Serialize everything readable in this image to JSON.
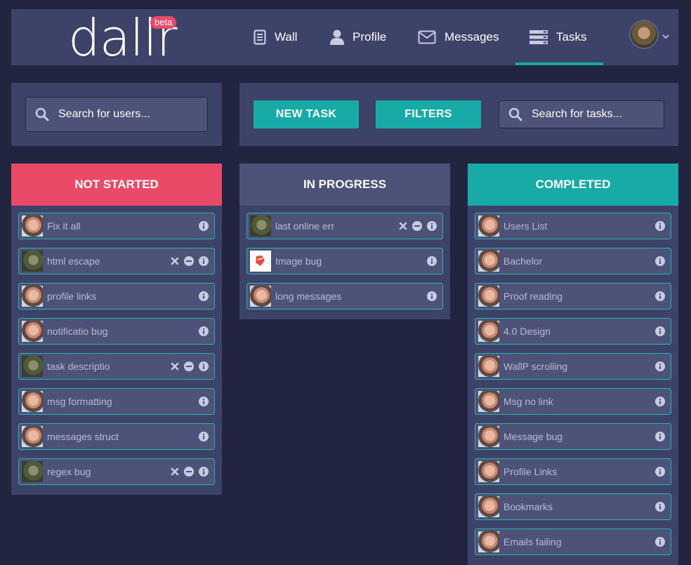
{
  "header": {
    "logo": "dallr",
    "badge": "beta",
    "nav": [
      {
        "label": "Wall",
        "icon": "document-icon"
      },
      {
        "label": "Profile",
        "icon": "user-icon"
      },
      {
        "label": "Messages",
        "icon": "envelope-icon"
      },
      {
        "label": "Tasks",
        "icon": "tasks-icon",
        "active": true
      }
    ]
  },
  "user_search": {
    "placeholder": "Search for users..."
  },
  "toolbar": {
    "new_task": "NEW TASK",
    "filters": "FILTERS",
    "task_search_placeholder": "Search for tasks..."
  },
  "columns": {
    "not_started": {
      "title": "NOT STARTED",
      "color": "#e94a67",
      "tasks": [
        {
          "label": "Fix it all",
          "actions": [
            "info"
          ]
        },
        {
          "label": "html escape",
          "actions": [
            "remove",
            "minus",
            "info"
          ]
        },
        {
          "label": "profile links",
          "actions": [
            "info"
          ]
        },
        {
          "label": "notificatio bug",
          "actions": [
            "info"
          ]
        },
        {
          "label": "task descriptio",
          "actions": [
            "remove",
            "minus",
            "info"
          ]
        },
        {
          "label": "msg formatting",
          "actions": [
            "info"
          ]
        },
        {
          "label": "messages struct",
          "actions": [
            "info"
          ]
        },
        {
          "label": "regex bug",
          "actions": [
            "remove",
            "minus",
            "info"
          ]
        }
      ]
    },
    "in_progress": {
      "title": "IN PROGRESS",
      "color": "#4d5278",
      "tasks": [
        {
          "label": "last online err",
          "actions": [
            "remove",
            "minus",
            "info"
          ]
        },
        {
          "label": "Image bug",
          "actions": [
            "info"
          ]
        },
        {
          "label": "long messages",
          "actions": [
            "info"
          ]
        }
      ]
    },
    "completed": {
      "title": "COMPLETED",
      "color": "#17aaa6",
      "tasks": [
        {
          "label": "Users List",
          "actions": [
            "info"
          ]
        },
        {
          "label": "Bachelor",
          "actions": [
            "info"
          ]
        },
        {
          "label": "Proof reading",
          "actions": [
            "info"
          ]
        },
        {
          "label": "4.0 Design",
          "actions": [
            "info"
          ]
        },
        {
          "label": "WallP scrolling",
          "actions": [
            "info"
          ]
        },
        {
          "label": "Msg no link",
          "actions": [
            "info"
          ]
        },
        {
          "label": "Message bug",
          "actions": [
            "info"
          ]
        },
        {
          "label": "Profile Links",
          "actions": [
            "info"
          ]
        },
        {
          "label": "Bookmarks",
          "actions": [
            "info"
          ]
        },
        {
          "label": "Emails failing",
          "actions": [
            "info"
          ]
        }
      ]
    }
  },
  "colors": {
    "accent": "#17aaa6",
    "danger": "#e94a67",
    "panel": "#3d4268",
    "bg": "#222540"
  }
}
